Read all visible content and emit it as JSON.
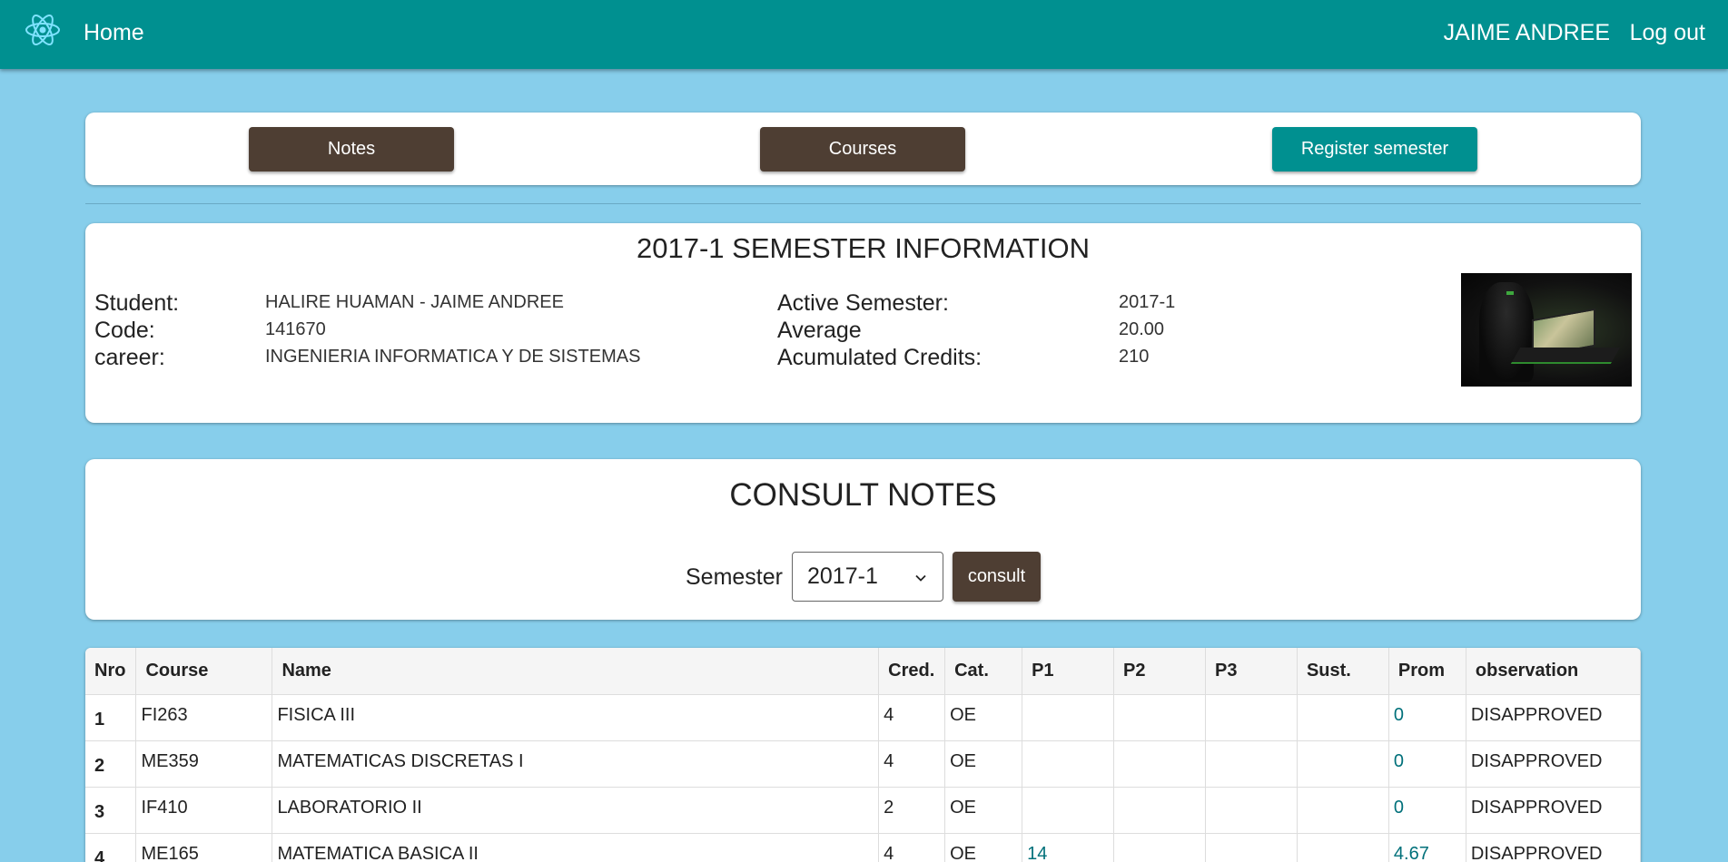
{
  "navbar": {
    "home_label": "Home",
    "user_name": "JAIME ANDREE",
    "logout_label": "Log out"
  },
  "actions": {
    "notes_label": "Notes",
    "courses_label": "Courses",
    "register_label": "Register semester"
  },
  "semester_info": {
    "title": "2017-1 SEMESTER INFORMATION",
    "student_label": "Student:",
    "student_value": "HALIRE HUAMAN - JAIME ANDREE",
    "code_label": "Code:",
    "code_value": "141670",
    "career_label": "career:",
    "career_value": "INGENIERIA INFORMATICA Y DE SISTEMAS",
    "active_label": "Active Semester:",
    "active_value": "2017-1",
    "average_label": "Average",
    "average_value": "20.00",
    "credits_label": "Acumulated Credits:",
    "credits_value": "210"
  },
  "consult": {
    "title": "CONSULT NOTES",
    "semester_label": "Semester",
    "semester_selected": "2017-1",
    "consult_label": "consult"
  },
  "table": {
    "headers": [
      "Nro",
      "Course",
      "Name",
      "Cred.",
      "Cat.",
      "P1",
      "P2",
      "P3",
      "Sust.",
      "Prom",
      "observation"
    ],
    "rows": [
      {
        "nro": "1",
        "course": "FI263",
        "name": "FISICA III",
        "cred": "4",
        "cat": "OE",
        "p1": "",
        "p2": "",
        "p3": "",
        "sust": "",
        "prom": "0",
        "observation": "DISAPPROVED"
      },
      {
        "nro": "2",
        "course": "ME359",
        "name": "MATEMATICAS DISCRETAS I",
        "cred": "4",
        "cat": "OE",
        "p1": "",
        "p2": "",
        "p3": "",
        "sust": "",
        "prom": "0",
        "observation": "DISAPPROVED"
      },
      {
        "nro": "3",
        "course": "IF410",
        "name": "LABORATORIO II",
        "cred": "2",
        "cat": "OE",
        "p1": "",
        "p2": "",
        "p3": "",
        "sust": "",
        "prom": "0",
        "observation": "DISAPPROVED"
      },
      {
        "nro": "4",
        "course": "ME165",
        "name": "MATEMATICA BASICA II",
        "cred": "4",
        "cat": "OE",
        "p1": "14",
        "p2": "",
        "p3": "",
        "sust": "",
        "prom": "4.67",
        "observation": "DISAPPROVED"
      }
    ]
  }
}
